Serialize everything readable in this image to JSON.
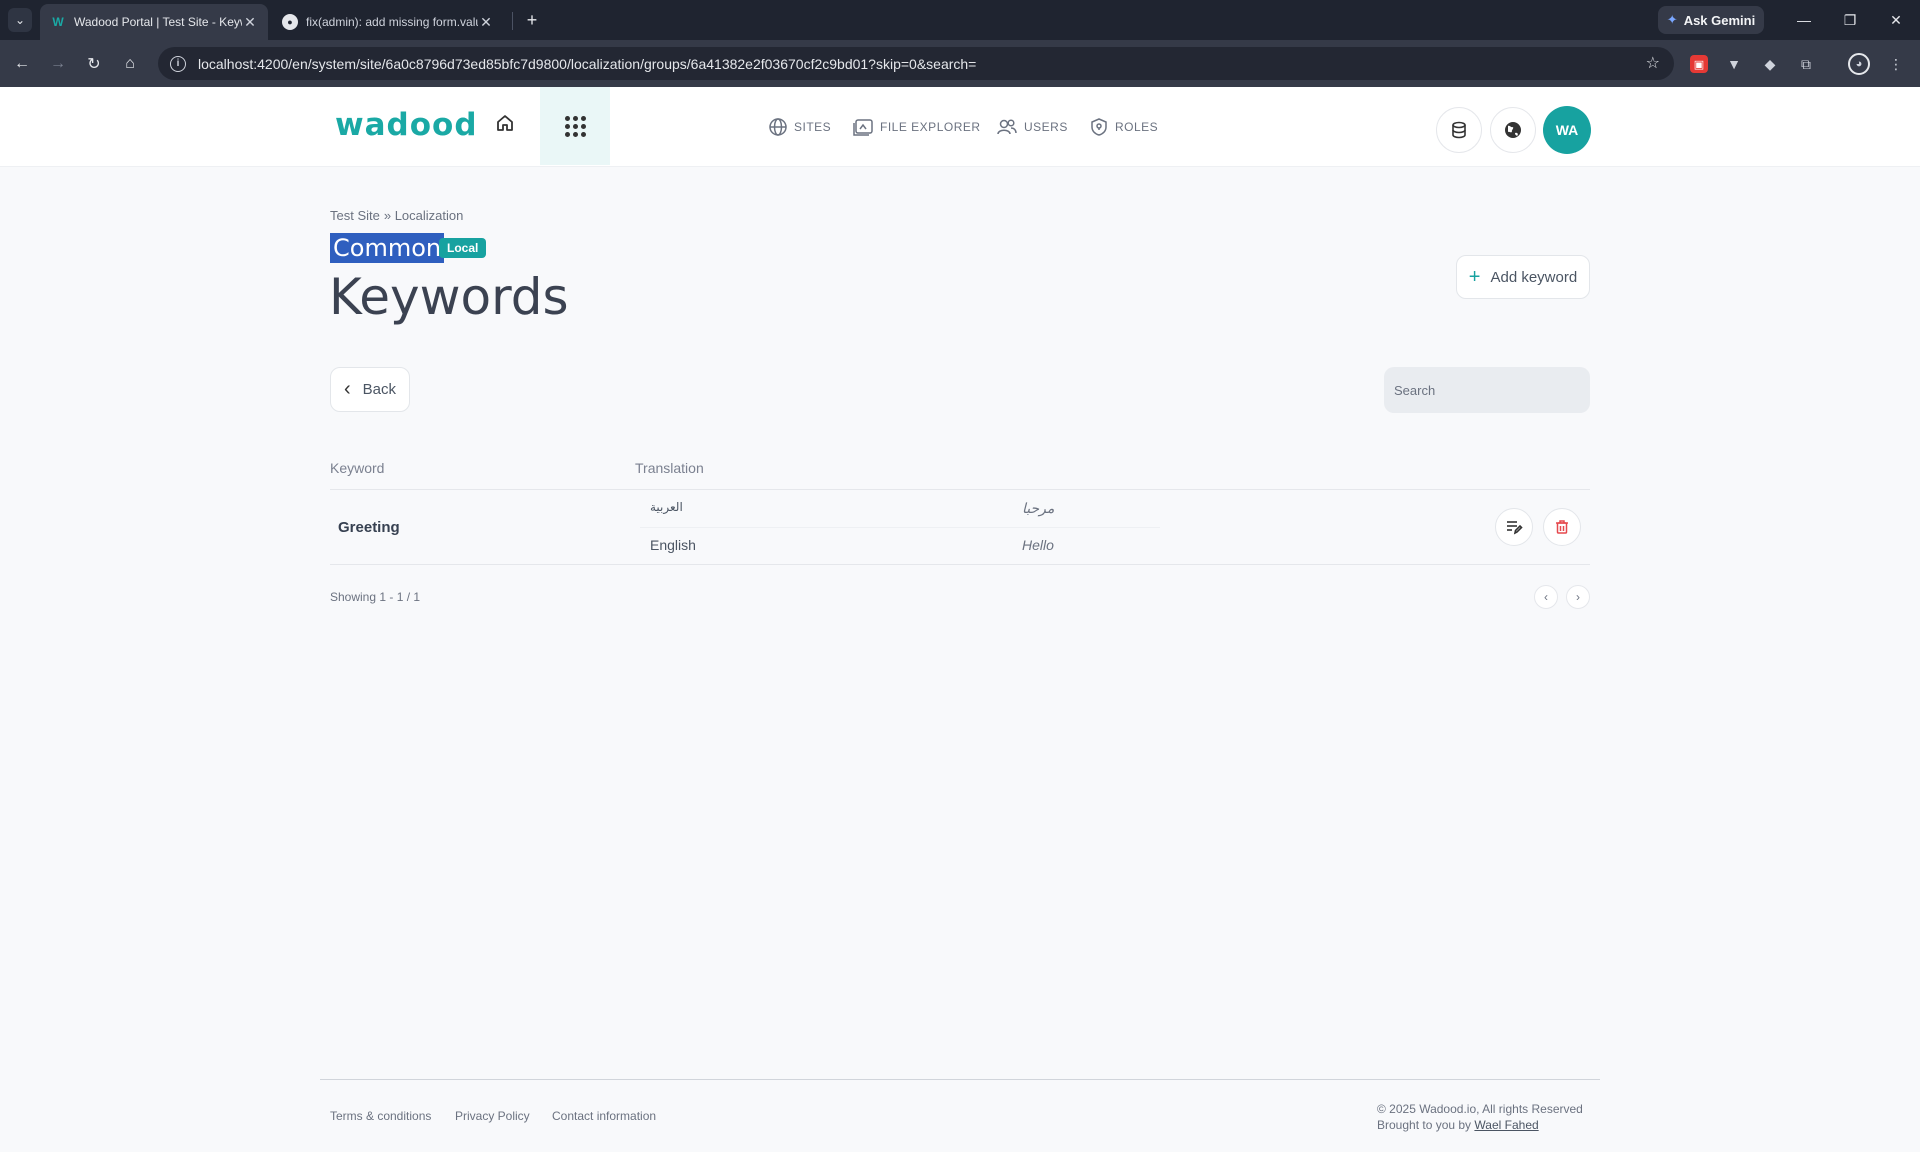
{
  "browser": {
    "tabs": [
      {
        "title": "Wadood Portal | Test Site - Keywords",
        "active": true
      },
      {
        "title": "fix(admin): add missing form.value",
        "active": false
      }
    ],
    "new_tab": "+",
    "gemini_label": "Ask Gemini",
    "url": "localhost:4200/en/system/site/6a0c8796d73ed85bfc7d9800/localization/groups/6a41382e2f03670cf2c9bd01?skip=0&search="
  },
  "header": {
    "logo": "wadood",
    "nav": [
      {
        "label": "SITES",
        "icon": "globe-icon"
      },
      {
        "label": "FILE EXPLORER",
        "icon": "folder-icon"
      },
      {
        "label": "USERS",
        "icon": "users-icon"
      },
      {
        "label": "ROLES",
        "icon": "shield-icon"
      }
    ],
    "avatar_initials": "WA"
  },
  "breadcrumb": [
    "Test Site",
    "» Localization"
  ],
  "group": {
    "title": "Common",
    "badge": "Local"
  },
  "page_title": "Keywords",
  "actions": {
    "add_keyword": "Add keyword",
    "back": "Back",
    "search_placeholder": "Search"
  },
  "table": {
    "headers": [
      "Keyword",
      "Translation"
    ],
    "rows": [
      {
        "keyword": "Greeting",
        "translations": [
          {
            "language": "العربية",
            "value": "مرحبا"
          },
          {
            "language": "English",
            "value": "Hello"
          }
        ]
      }
    ]
  },
  "pagination": {
    "showing": "Showing 1 - 1 / 1"
  },
  "footer": {
    "links": [
      "Terms & conditions",
      "Privacy Policy",
      "Contact information"
    ],
    "copyright": "© 2025 Wadood.io, All rights Reserved",
    "credit_prefix": "Brought to you by",
    "credit_name": "Wael Fahed"
  },
  "colors": {
    "accent": "#17a2a0",
    "selection": "#2f5fbf",
    "delete": "#e5484d"
  }
}
